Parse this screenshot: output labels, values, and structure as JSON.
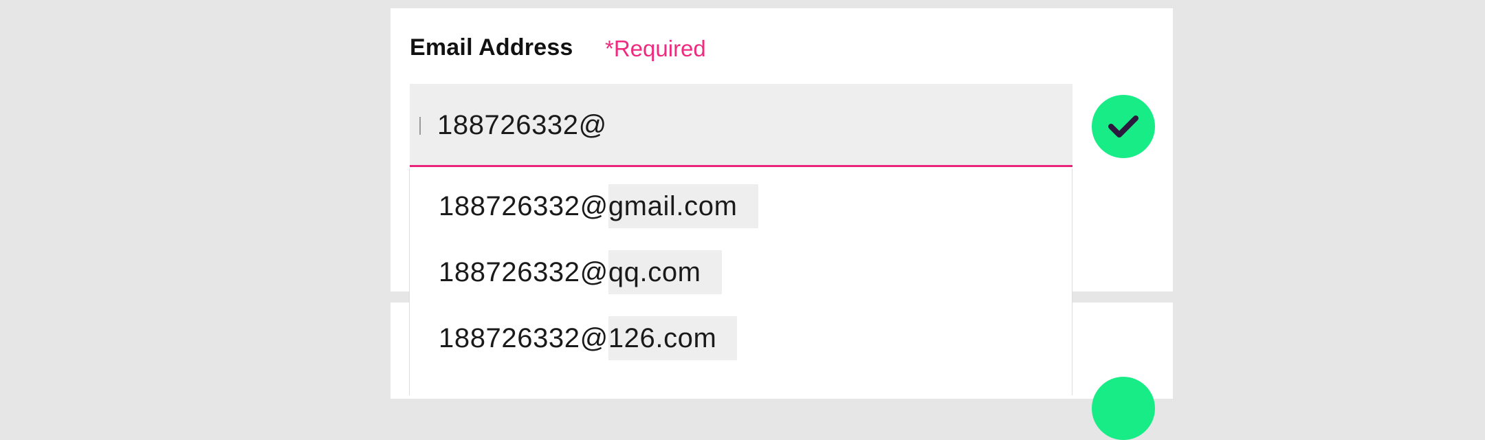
{
  "form": {
    "email_label": "Email Address",
    "required_label": "*Required",
    "email_value": "188726332@",
    "valid_icon": "check-icon"
  },
  "suggestions": [
    {
      "local": "188726332@",
      "domain": "gmail.com"
    },
    {
      "local": "188726332@",
      "domain": "qq.com"
    },
    {
      "local": "188726332@",
      "domain": "126.com"
    }
  ],
  "colors": {
    "accent": "#e8247a",
    "valid": "#17ec86",
    "check_mark": "#2b1a3d",
    "background": "#e6e6e6"
  }
}
